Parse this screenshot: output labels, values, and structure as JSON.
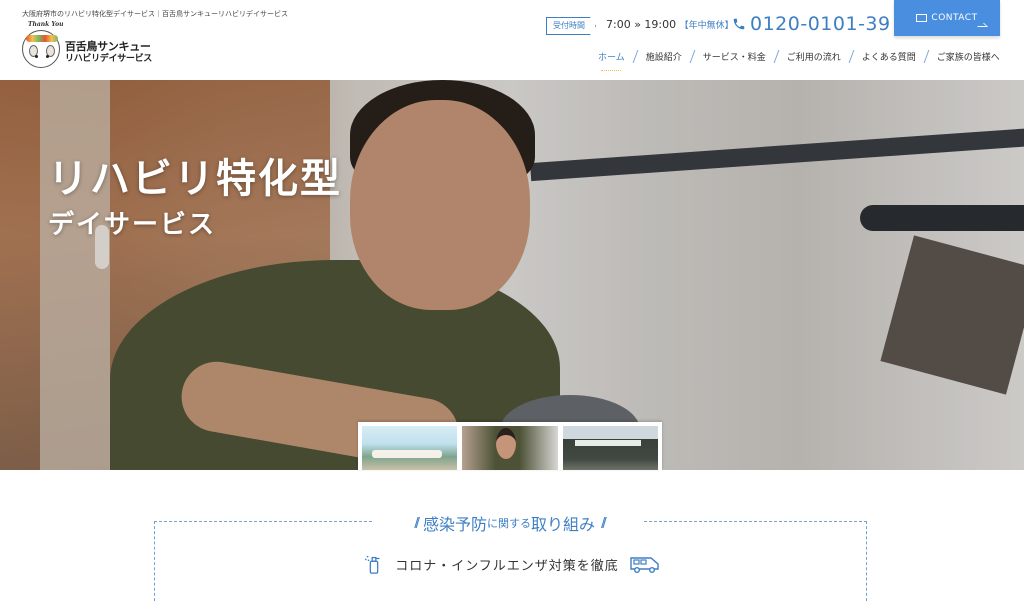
{
  "header": {
    "tagline": "大阪府堺市のリハビリ特化型デイサービス｜百舌鳥サンキューリハビリデイサービス",
    "logo": {
      "thankyou": "Thank You",
      "name": "百舌鳥サンキュー",
      "sub": "リハビリデイサービス"
    },
    "hours": {
      "badge": "受付時間",
      "time": "7:00 » 19:00",
      "note": "【年中無休】"
    },
    "phone": "0120-0101-39",
    "contact_label": "CONTACT"
  },
  "nav": {
    "items": [
      {
        "label": "ホーム",
        "active": true
      },
      {
        "label": "施設紹介",
        "active": false
      },
      {
        "label": "サービス・料金",
        "active": false
      },
      {
        "label": "ご利用の流れ",
        "active": false
      },
      {
        "label": "よくある質問",
        "active": false
      },
      {
        "label": "ご家族の皆様へ",
        "active": false
      }
    ]
  },
  "hero": {
    "title": "リハビリ特化型",
    "subtitle": "デイサービス",
    "thumbnails": [
      "thumb-1",
      "thumb-2",
      "thumb-3"
    ]
  },
  "notice": {
    "title_a": "感染予防",
    "title_b": "に関する",
    "title_c": "取り組み",
    "line": "コロナ・インフルエンザ対策を徹底"
  },
  "colors": {
    "accent": "#3e7fc4",
    "contact_bg": "#4a8ee0"
  },
  "icons": {
    "phone": "phone-icon",
    "mail": "mail-icon",
    "spray": "spray-icon",
    "van": "van-icon"
  }
}
